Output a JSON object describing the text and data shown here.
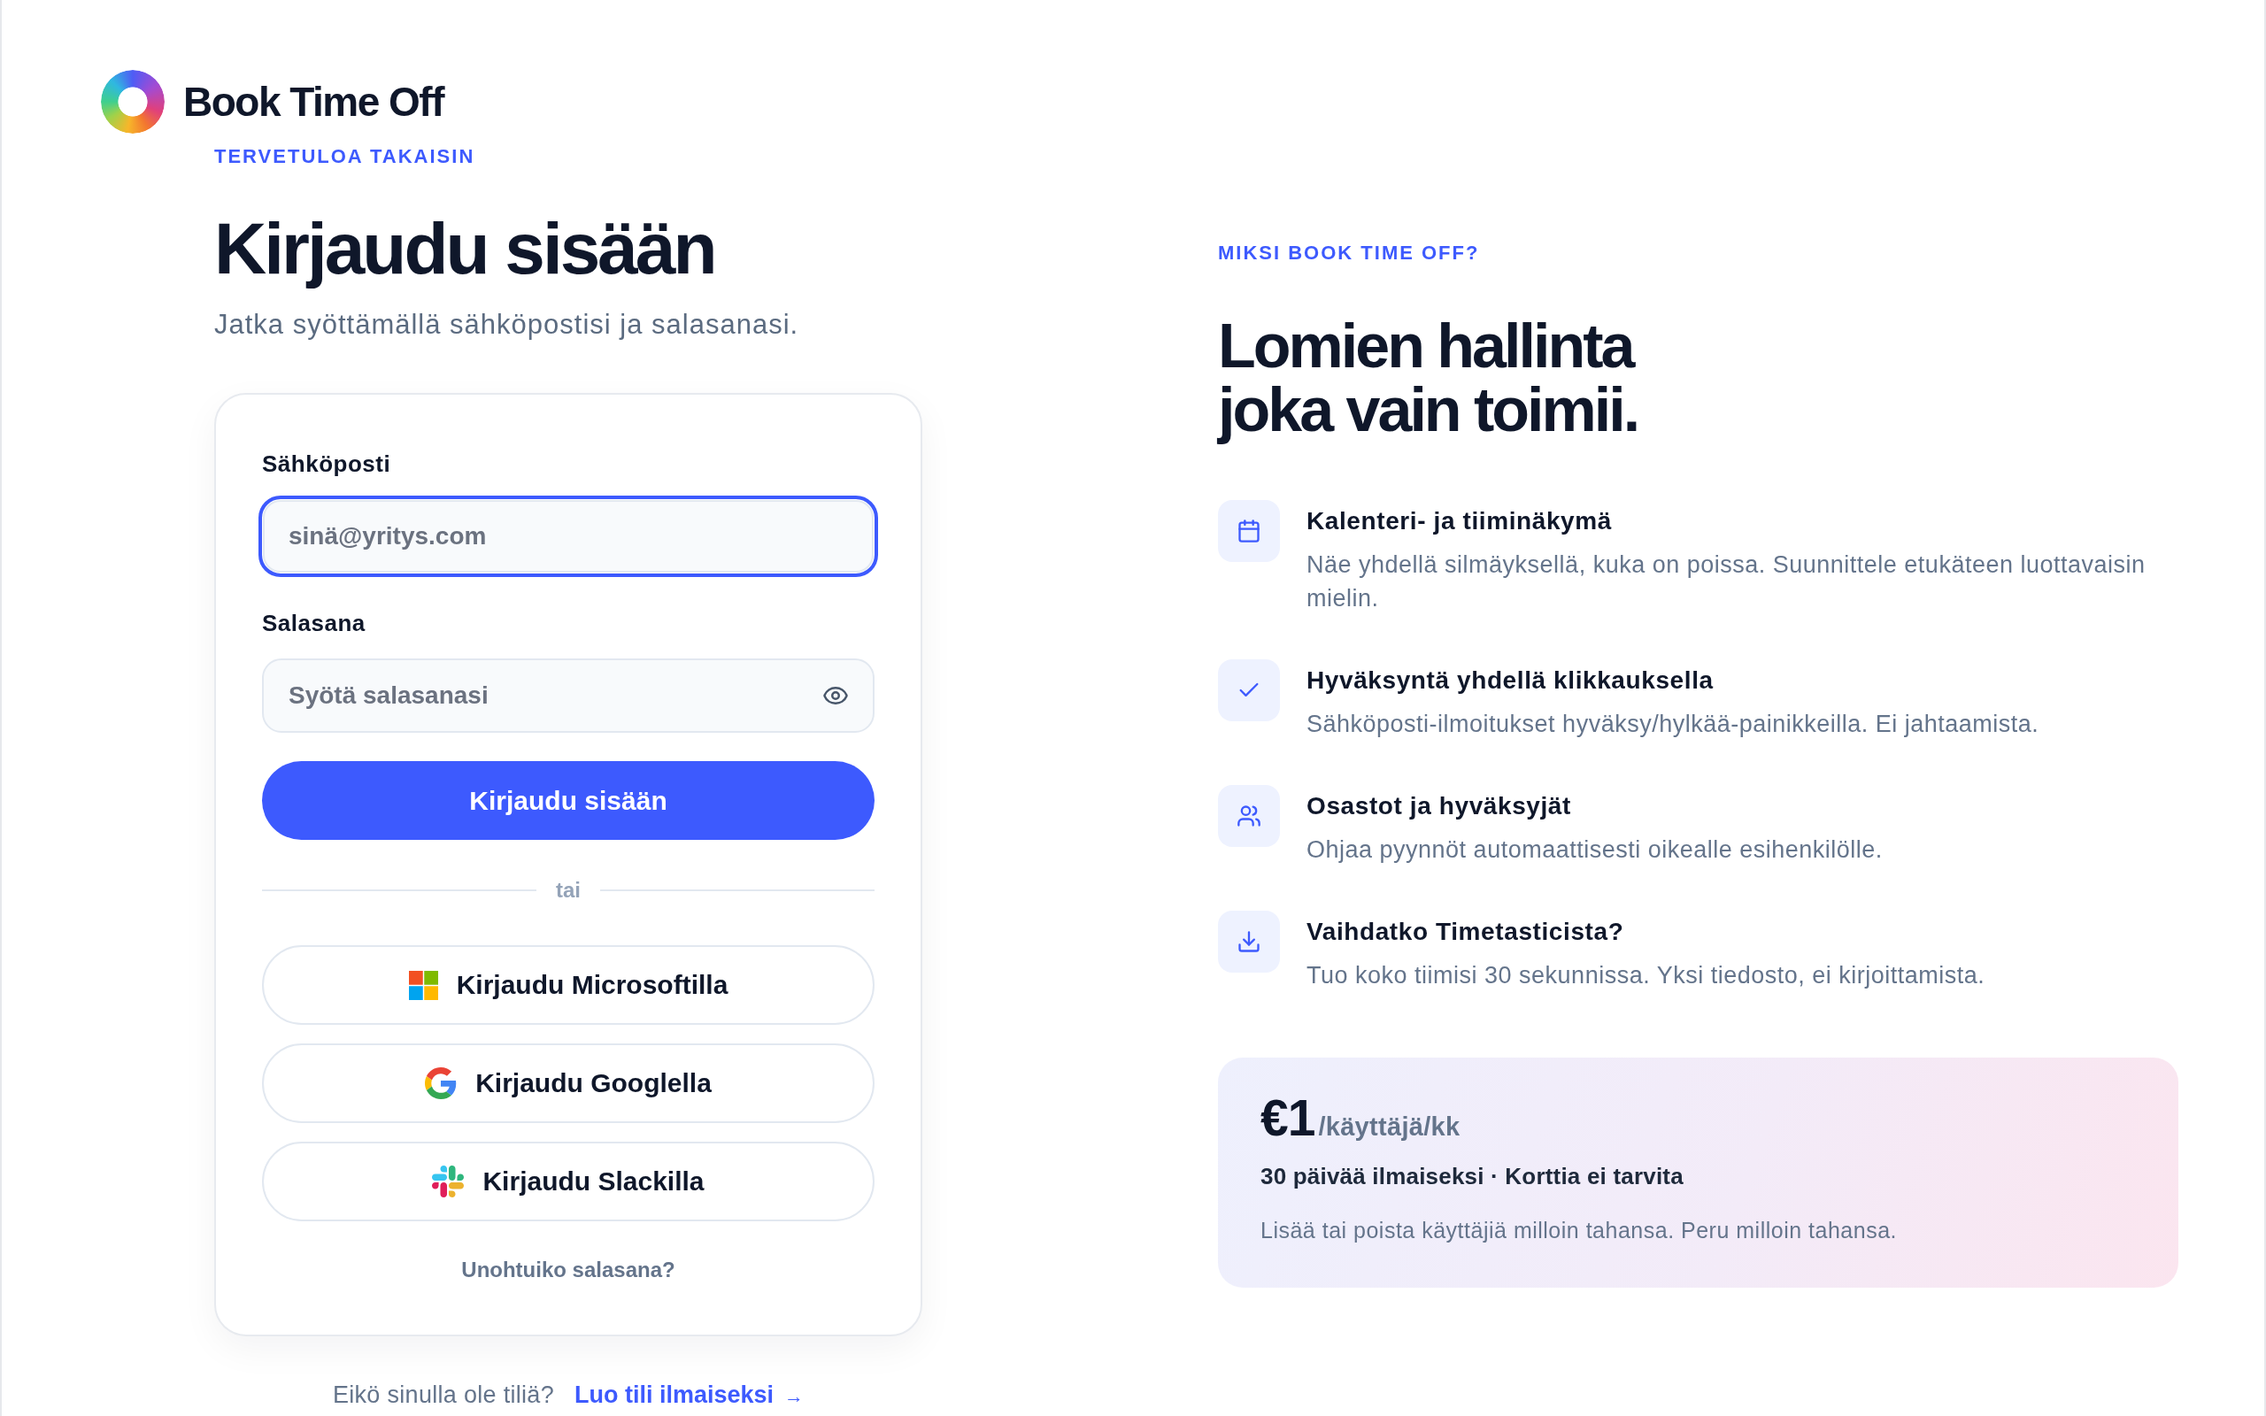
{
  "brand": {
    "name": "Book Time Off"
  },
  "login": {
    "eyebrow": "TERVETULOA TAKAISIN",
    "title": "Kirjaudu sisään",
    "subtitle": "Jatka syöttämällä sähköpostisi ja salasanasi.",
    "fields": [
      {
        "kind": "email",
        "label": "Sähköposti",
        "placeholder": "sinä@yritys.com",
        "focused": true
      },
      {
        "kind": "password",
        "label": "Salasana",
        "placeholder": "Syötä salasanasi",
        "focused": false
      }
    ],
    "submit": "Kirjaudu sisään",
    "divider": "tai",
    "providers": [
      {
        "kind": "microsoft",
        "label": "Kirjaudu Microsoftilla"
      },
      {
        "kind": "google",
        "label": "Kirjaudu Googlella"
      },
      {
        "kind": "slack",
        "label": "Kirjaudu Slackilla"
      }
    ],
    "forgot_link": "Unohtuiko salasana?",
    "signup": {
      "prompt": "Eikö sinulla ole tiliä?",
      "link": "Luo tili ilmaiseksi",
      "arrow": "→"
    }
  },
  "why": {
    "eyebrow": "MIKSI BOOK TIME OFF?",
    "title": "Lomien hallinta joka vain toimii.",
    "features": [
      {
        "title": "Kalenteri- ja tiiminäkymä",
        "text": "Näe yhdellä silmäyksellä, kuka on poissa. Suunnittele etukäteen luottavaisin mielin."
      },
      {
        "title": "Hyväksyntä yhdellä klikkauksella",
        "text": "Sähköposti-ilmoitukset hyväksy/hylkää-painikkeilla. Ei jahtaamista."
      },
      {
        "title": "Osastot ja hyväksyjät",
        "text": "Ohjaa pyynnöt automaattisesti oikealle esihenkilölle."
      },
      {
        "title": "Vaihdatko Timetasticista?",
        "text": "Tuo koko tiimisi 30 sekunnissa. Yksi tiedosto, ei kirjoittamista."
      }
    ],
    "pricing": {
      "price": "€1",
      "unit": "/käyttäjä/kk",
      "headline": "30 päivää ilmaiseksi · Korttia ei tarvita",
      "note": "Lisää tai poista käyttäjiä milloin tahansa. Peru milloin tahansa."
    }
  }
}
